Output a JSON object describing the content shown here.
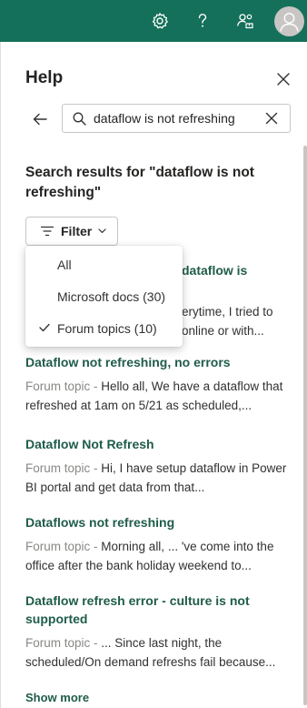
{
  "topbar": {
    "background": "#14705a",
    "icons": [
      "gear-icon",
      "help-icon",
      "share-icon",
      "avatar-icon"
    ]
  },
  "help": {
    "title": "Help",
    "search": {
      "value": "dataflow is not refreshing"
    },
    "results_heading": "Search results for \"dataflow is not refreshing\"",
    "filter": {
      "label": "Filter",
      "options": [
        {
          "label": "All",
          "selected": false
        },
        {
          "label": "Microsoft docs (30)",
          "selected": false
        },
        {
          "label": "Forum topics (10)",
          "selected": true
        }
      ]
    },
    "results": [
      {
        "title_visible": "dataflow is",
        "snippet_line1": "erytime, I tried to",
        "snippet_line2": "online or with..."
      },
      {
        "title": "Dataflow not refreshing, no errors",
        "kind": "Forum topic - ",
        "snippet": "Hello all, We have a dataflow that refreshed at 1am on 5/21 as scheduled,..."
      },
      {
        "title": "Dataflow Not Refresh",
        "kind": "Forum topic - ",
        "snippet": "Hi, I have setup dataflow in Power BI portal and get data from that..."
      },
      {
        "title": "Dataflows not refreshing",
        "kind": "Forum topic - ",
        "snippet": "Morning all, ... 've come into the office after the bank holiday weekend to..."
      },
      {
        "title": "Dataflow refresh error - culture is not supported",
        "kind": "Forum topic - ",
        "snippet": "... Since last night, the scheduled/On demand refreshs fail because..."
      }
    ],
    "show_more": "Show more"
  },
  "colors": {
    "accent": "#14705a",
    "link": "#1f5c4a",
    "muted": "#8a8886"
  }
}
